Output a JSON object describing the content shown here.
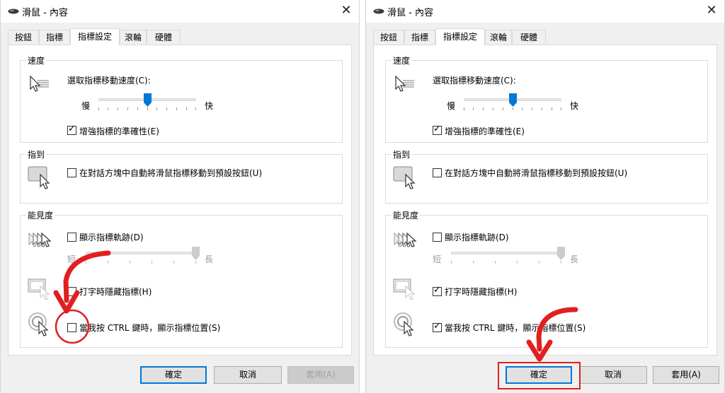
{
  "colors": {
    "accent": "#0078d7",
    "annotation": "#e02020"
  },
  "left": {
    "window_title": "滑鼠 - 內容",
    "tabs": [
      "按鈕",
      "指標",
      "指標設定",
      "滾輪",
      "硬體"
    ],
    "active_tab": "指標設定",
    "speed": {
      "group_label": "速度",
      "prompt": "選取指標移動速度(C):",
      "slow": "慢",
      "fast": "快",
      "slider_level": 0.5,
      "enhance_label": "增強指標的準確性(E)",
      "enhance_checked": true
    },
    "snapto": {
      "group_label": "指到",
      "label": "在對話方塊中自動將滑鼠指標移動到預設按鈕(U)",
      "checked": false
    },
    "visibility": {
      "group_label": "能見度",
      "trails_label": "顯示指標軌跡(D)",
      "trails_checked": false,
      "short": "短",
      "long": "長",
      "trail_level": 1.0,
      "hide_label": "打字時隱藏指標(H)",
      "hide_checked": false,
      "ctrl_label": "當我按 CTRL 鍵時，顯示指標位置(S)",
      "ctrl_checked": false
    },
    "buttons": {
      "ok": "確定",
      "cancel": "取消",
      "apply": "套用(A)"
    },
    "apply_enabled": false
  },
  "right": {
    "window_title": "滑鼠 - 內容",
    "tabs": [
      "按鈕",
      "指標",
      "指標設定",
      "滾輪",
      "硬體"
    ],
    "active_tab": "指標設定",
    "speed": {
      "group_label": "速度",
      "prompt": "選取指標移動速度(C):",
      "slow": "慢",
      "fast": "快",
      "slider_level": 0.5,
      "enhance_label": "增強指標的準確性(E)",
      "enhance_checked": true
    },
    "snapto": {
      "group_label": "指到",
      "label": "在對話方塊中自動將滑鼠指標移動到預設按鈕(U)",
      "checked": false
    },
    "visibility": {
      "group_label": "能見度",
      "trails_label": "顯示指標軌跡(D)",
      "trails_checked": false,
      "short": "短",
      "long": "長",
      "trail_level": 1.0,
      "hide_label": "打字時隱藏指標(H)",
      "hide_checked": true,
      "ctrl_label": "當我按 CTRL 鍵時，顯示指標位置(S)",
      "ctrl_checked": true
    },
    "buttons": {
      "ok": "確定",
      "cancel": "取消",
      "apply": "套用(A)"
    },
    "apply_enabled": true
  }
}
